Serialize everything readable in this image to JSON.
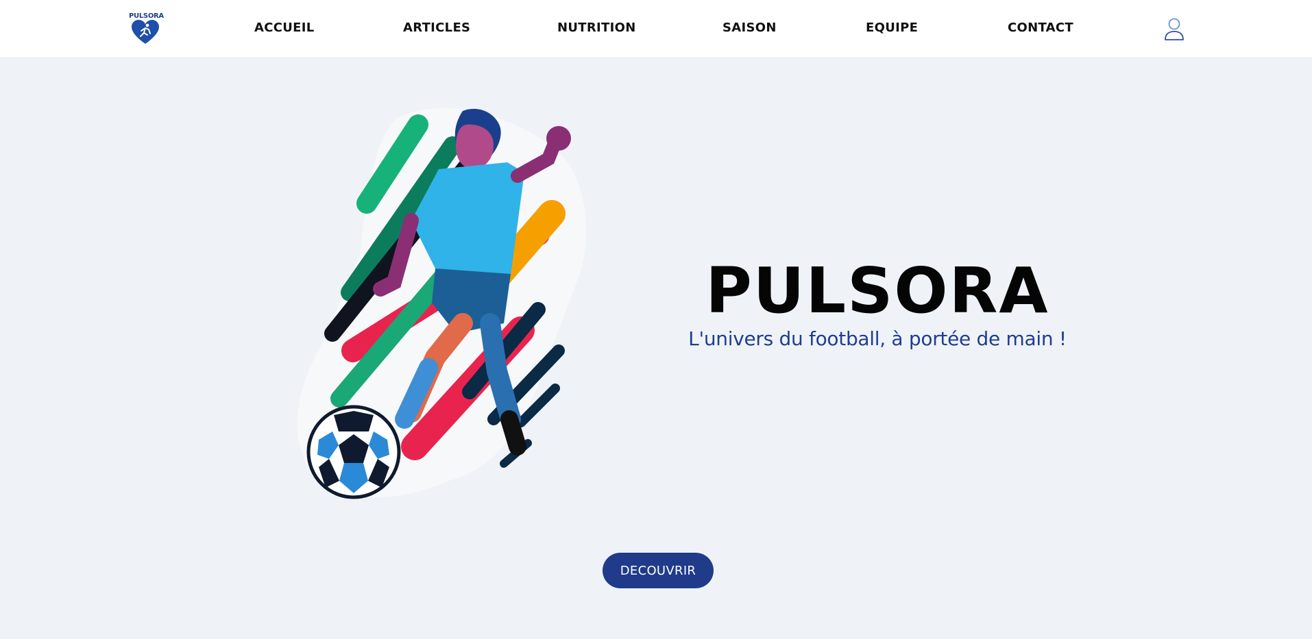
{
  "logo": {
    "text": "PULSORA"
  },
  "nav": {
    "items": [
      {
        "label": "ACCUEIL"
      },
      {
        "label": "ARTICLES"
      },
      {
        "label": "NUTRITION"
      },
      {
        "label": "SAISON"
      },
      {
        "label": "EQUIPE"
      },
      {
        "label": "CONTACT"
      }
    ]
  },
  "hero": {
    "title": "PULSORA",
    "tagline": "L'univers du football, à portée de main !",
    "cta_label": "DECOUVRIR",
    "image": "football-player-kicking-ball"
  },
  "icons": {
    "user": "user-icon"
  },
  "colors": {
    "brand_blue": "#1f3b8a",
    "background": "#eff3f8",
    "nav_background": "#ffffff"
  }
}
